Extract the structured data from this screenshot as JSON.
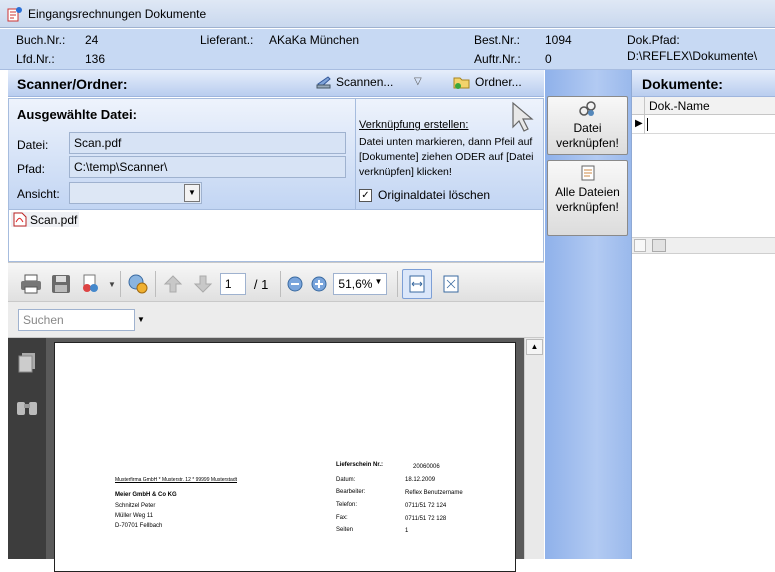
{
  "window": {
    "title": "Eingangsrechnungen Dokumente"
  },
  "info": {
    "buch_label": "Buch.Nr.:",
    "buch_value": "24",
    "lfd_label": "Lfd.Nr.:",
    "lfd_value": "136",
    "lieferant_label": "Lieferant.:",
    "lieferant_value": "AKaKa München",
    "best_label": "Best.Nr.:",
    "best_value": "1094",
    "auftr_label": "Auftr.Nr.:",
    "auftr_value": "0",
    "dokpfad_label": "Dok.Pfad:",
    "dokpfad_value": "D:\\REFLEX\\Dokumente\\"
  },
  "scanner": {
    "title": "Scanner/Ordner:",
    "scan_label": "Scannen...",
    "ordner_label": "Ordner...",
    "selected_title": "Ausgewählte Datei:",
    "datei_label": "Datei:",
    "datei_value": "Scan.pdf",
    "pfad_label": "Pfad:",
    "pfad_value": "C:\\temp\\Scanner\\",
    "ansicht_label": "Ansicht:",
    "ansicht_value": "",
    "link_title": "Verknüpfung erstellen:",
    "link_text": "Datei unten markieren, dann Pfeil auf [Dokumente] ziehen ODER auf [Datei verknüpfen] klicken!",
    "delete_label": "Originaldatei löschen",
    "delete_checked": true,
    "files": [
      "Scan.pdf"
    ]
  },
  "pdf": {
    "page_current": "1",
    "page_total": "/ 1",
    "zoom": "51,6%",
    "search_placeholder": "Suchen",
    "doc": {
      "sender_line": "Musterfirma GmbH * Musterstr. 12 * 99999 Musterstadt",
      "recipient": [
        "Meier GmbH & Co KG",
        "Schnitzel Peter",
        "Müller Weg 11",
        "D-70701 Fellbach"
      ],
      "ls_label": "Lieferschein Nr.:",
      "ls_value": "20060006",
      "rows": [
        {
          "k": "Datum:",
          "v": "18.12.2009"
        },
        {
          "k": "Bearbeiter:",
          "v": "Reflex Benutzername"
        },
        {
          "k": "Telefon:",
          "v": "0711/51 72 124"
        },
        {
          "k": "Fax:",
          "v": "0711/51 72 128"
        },
        {
          "k": "Seiten",
          "v": "1"
        }
      ]
    }
  },
  "actions": {
    "link_file": "Datei verknüpfen!",
    "link_all": "Alle Dateien verknüpfen!"
  },
  "documents": {
    "title": "Dokumente:",
    "col_name": "Dok.-Name"
  }
}
